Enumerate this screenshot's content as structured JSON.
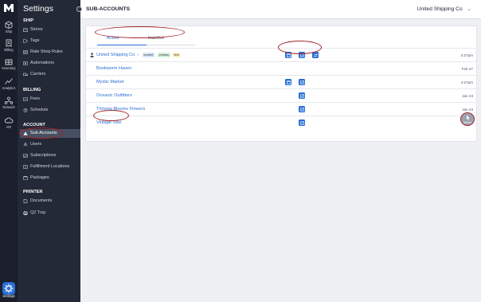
{
  "rail": {
    "items": [
      {
        "label": "Ship",
        "icon": "box-icon"
      },
      {
        "label": "Billing",
        "icon": "receipt-icon"
      },
      {
        "label": "Inventory",
        "icon": "warehouse-icon"
      },
      {
        "label": "Analytics",
        "icon": "chart-icon"
      },
      {
        "label": "Network",
        "icon": "network-icon"
      },
      {
        "label": "API",
        "icon": "cloud-icon"
      }
    ],
    "settings_label": "Settings"
  },
  "sidebar": {
    "title": "Settings",
    "sections": {
      "ship": "SHIP",
      "billing": "BILLING",
      "account": "ACCOUNT",
      "printer": "PRINTER"
    },
    "ship_items": [
      {
        "label": "Stores",
        "icon": "store-icon"
      },
      {
        "label": "Tags",
        "icon": "tag-icon"
      },
      {
        "label": "Rate Shop Rules",
        "icon": "rules-icon"
      },
      {
        "label": "Automations",
        "icon": "automation-icon"
      },
      {
        "label": "Carriers",
        "icon": "truck-icon"
      }
    ],
    "billing_items": [
      {
        "label": "Fees",
        "icon": "fees-icon"
      },
      {
        "label": "Schedule",
        "icon": "clock-icon"
      }
    ],
    "account_items": [
      {
        "label": "Sub-Accounts",
        "icon": "sub-accounts-icon",
        "active": true
      },
      {
        "label": "Users",
        "icon": "users-icon"
      },
      {
        "label": "Subscriptions",
        "icon": "subscriptions-icon"
      },
      {
        "label": "Fulfillment Locations",
        "icon": "location-icon"
      },
      {
        "label": "Packages",
        "icon": "package-icon"
      }
    ],
    "printer_items": [
      {
        "label": "Documents",
        "icon": "document-icon"
      },
      {
        "label": "QZ Tray",
        "icon": "printer-icon"
      }
    ]
  },
  "header": {
    "title": "SUB-ACCOUNTS",
    "account": "United Shipping Co",
    "account_chevron": "⌄"
  },
  "tabs": {
    "active": "Active",
    "inactive": "Inactive"
  },
  "accounts": [
    {
      "name": "United Shipping Co",
      "date": "4:27pm",
      "badges": [
        "current",
        "primary",
        "test"
      ],
      "close": "×"
    },
    {
      "name": "Bookworm Haven",
      "date": "Feb 27"
    },
    {
      "name": "Mystic Market",
      "date": "4:27pm"
    },
    {
      "name": "Oceanic Outfitters",
      "date": "Jan 23"
    },
    {
      "name": "Thriving Blooms Flowers",
      "date": "Jan 23"
    },
    {
      "name": "Vintage Vibe",
      "date": ""
    }
  ],
  "select_label": "Select",
  "colors": {
    "accent": "#2b6fd6",
    "annotation": "#a3242a",
    "sidebar": "#232936",
    "rail": "#1a1f2b"
  }
}
